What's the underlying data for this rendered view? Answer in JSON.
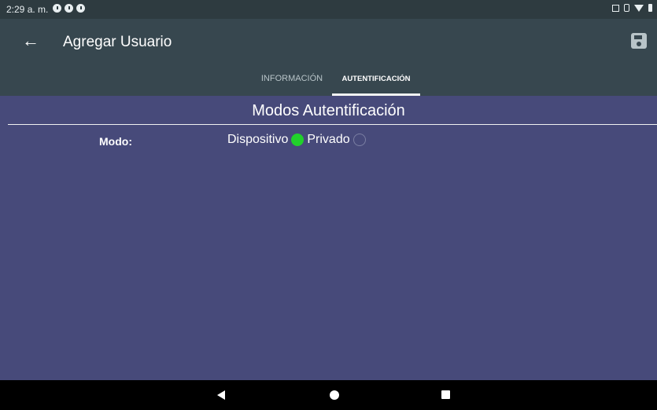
{
  "status_bar": {
    "time": "2:29 a. m.",
    "icons": [
      "notification-icon",
      "notification-icon",
      "notification-icon",
      "screenshot-icon",
      "vibrate-icon",
      "wifi-icon",
      "battery-icon"
    ]
  },
  "app_bar": {
    "title": "Agregar Usuario",
    "back_icon": "arrow-left-icon",
    "save_icon": "save-icon"
  },
  "tabs": [
    {
      "label": "INFORMACIÓN",
      "selected": false
    },
    {
      "label": "AUTENTIFICACIÓN",
      "selected": true
    }
  ],
  "content": {
    "section_title": "Modos Autentificación",
    "mode_label": "Modo:",
    "options": [
      {
        "label": "Dispositivo",
        "selected": true
      },
      {
        "label": "Privado",
        "selected": false
      }
    ]
  },
  "colors": {
    "app_bar": "#37474f",
    "status_bar": "#2e3b40",
    "content_background": "#474a7a",
    "radio_selected": "#21d12b"
  }
}
